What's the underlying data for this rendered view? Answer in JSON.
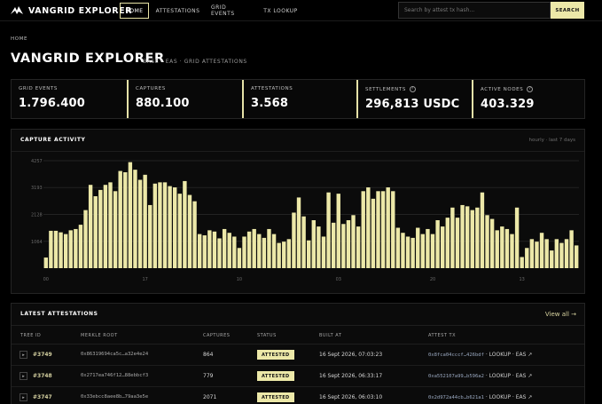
{
  "nav": {
    "logo_text": "VANGRID EXPLORER",
    "tabs": [
      {
        "label": "HOME",
        "active": true
      },
      {
        "label": "ATTESTATIONS",
        "active": false
      },
      {
        "label": "GRID EVENTS",
        "active": false
      },
      {
        "label": "TX LOOKUP",
        "active": false
      }
    ],
    "search_placeholder": "Search by attest tx hash...",
    "search_button": "SEARCH"
  },
  "header": {
    "breadcrumb": "HOME",
    "title": "VANGRID EXPLORER",
    "subtitle": "BASE · EAS · GRID ATTESTATIONS"
  },
  "stats": [
    {
      "label": "GRID EVENTS",
      "value": "1.796.400",
      "info": false
    },
    {
      "label": "CAPTURES",
      "value": "880.100",
      "info": false
    },
    {
      "label": "ATTESTATIONS",
      "value": "3.568",
      "info": false
    },
    {
      "label": "SETTLEMENTS",
      "value": "296,813 USDC",
      "info": true
    },
    {
      "label": "ACTIVE NODES",
      "value": "403.329",
      "info": true
    }
  ],
  "chart": {
    "title": "CAPTURE ACTIVITY",
    "note": "hourly · last 7 days"
  },
  "chart_data": {
    "type": "bar",
    "title": "CAPTURE ACTIVITY",
    "ylabel": "",
    "xlabel": "",
    "ylim": [
      0,
      4257
    ],
    "yticks": [
      "4257",
      "3193",
      "2128",
      "1064"
    ],
    "ytick_values": [
      4257,
      3193,
      2128,
      1064
    ],
    "xticks": [
      {
        "label": "00",
        "index": 0
      },
      {
        "label": "17",
        "index": 20
      },
      {
        "label": "10",
        "index": 39
      },
      {
        "label": "03",
        "index": 59
      },
      {
        "label": "20",
        "index": 78
      },
      {
        "label": "13",
        "index": 96
      }
    ],
    "values": [
      420,
      1480,
      1480,
      1420,
      1350,
      1500,
      1550,
      1720,
      2300,
      3300,
      2850,
      3100,
      3300,
      3400,
      3050,
      3850,
      3800,
      4200,
      3900,
      3500,
      3700,
      2500,
      3350,
      3400,
      3400,
      3250,
      3200,
      2950,
      3450,
      2900,
      2650,
      1350,
      1300,
      1500,
      1450,
      1180,
      1550,
      1400,
      1250,
      800,
      1250,
      1450,
      1550,
      1350,
      1200,
      1550,
      1350,
      1000,
      1050,
      1150,
      2200,
      2800,
      2050,
      1100,
      1900,
      1650,
      1250,
      3000,
      1800,
      2950,
      1750,
      1900,
      2100,
      1650,
      3050,
      3200,
      2750,
      3050,
      3050,
      3200,
      3050,
      1600,
      1400,
      1250,
      1200,
      1600,
      1350,
      1550,
      1350,
      1900,
      1650,
      2000,
      2400,
      2000,
      2500,
      2450,
      2300,
      2400,
      3000,
      2100,
      1950,
      1500,
      1650,
      1550,
      1350,
      2400,
      440,
      800,
      1150,
      1050,
      1400,
      1150,
      700,
      1150,
      1000,
      1150,
      1500,
      900
    ]
  },
  "table": {
    "title": "LATEST ATTESTATIONS",
    "view_all": "View all →",
    "columns": [
      "TREE ID",
      "MERKLE ROOT",
      "CAPTURES",
      "STATUS",
      "BUILT AT",
      "ATTEST TX"
    ],
    "rows": [
      {
        "tree_id": "#3749",
        "merkle_root": "0x86319694ca5c…a32e4e24",
        "captures": "864",
        "status": "ATTESTED",
        "built_at": "16 Sept 2026, 07:03:23",
        "tx_hash": "0x8fca04cccf…426bdf",
        "tx_links": "· LOOKUP · EAS ↗"
      },
      {
        "tree_id": "#3748",
        "merkle_root": "0x2717ea746f12…88ebbcf3",
        "captures": "779",
        "status": "ATTESTED",
        "built_at": "16 Sept 2026, 06:33:17",
        "tx_hash": "0xa552107a99…b596a2",
        "tx_links": "· LOOKUP · EAS ↗"
      },
      {
        "tree_id": "#3747",
        "merkle_root": "0x33ebcc8aee8b…79aa3e5e",
        "captures": "2071",
        "status": "ATTESTED",
        "built_at": "16 Sept 2026, 06:03:10",
        "tx_hash": "0x2d972a44cb…b621a1",
        "tx_links": "· LOOKUP · EAS ↗"
      }
    ]
  },
  "colors": {
    "accent": "#ece8a8",
    "background": "#000000",
    "panel": "#0b0b0b"
  }
}
